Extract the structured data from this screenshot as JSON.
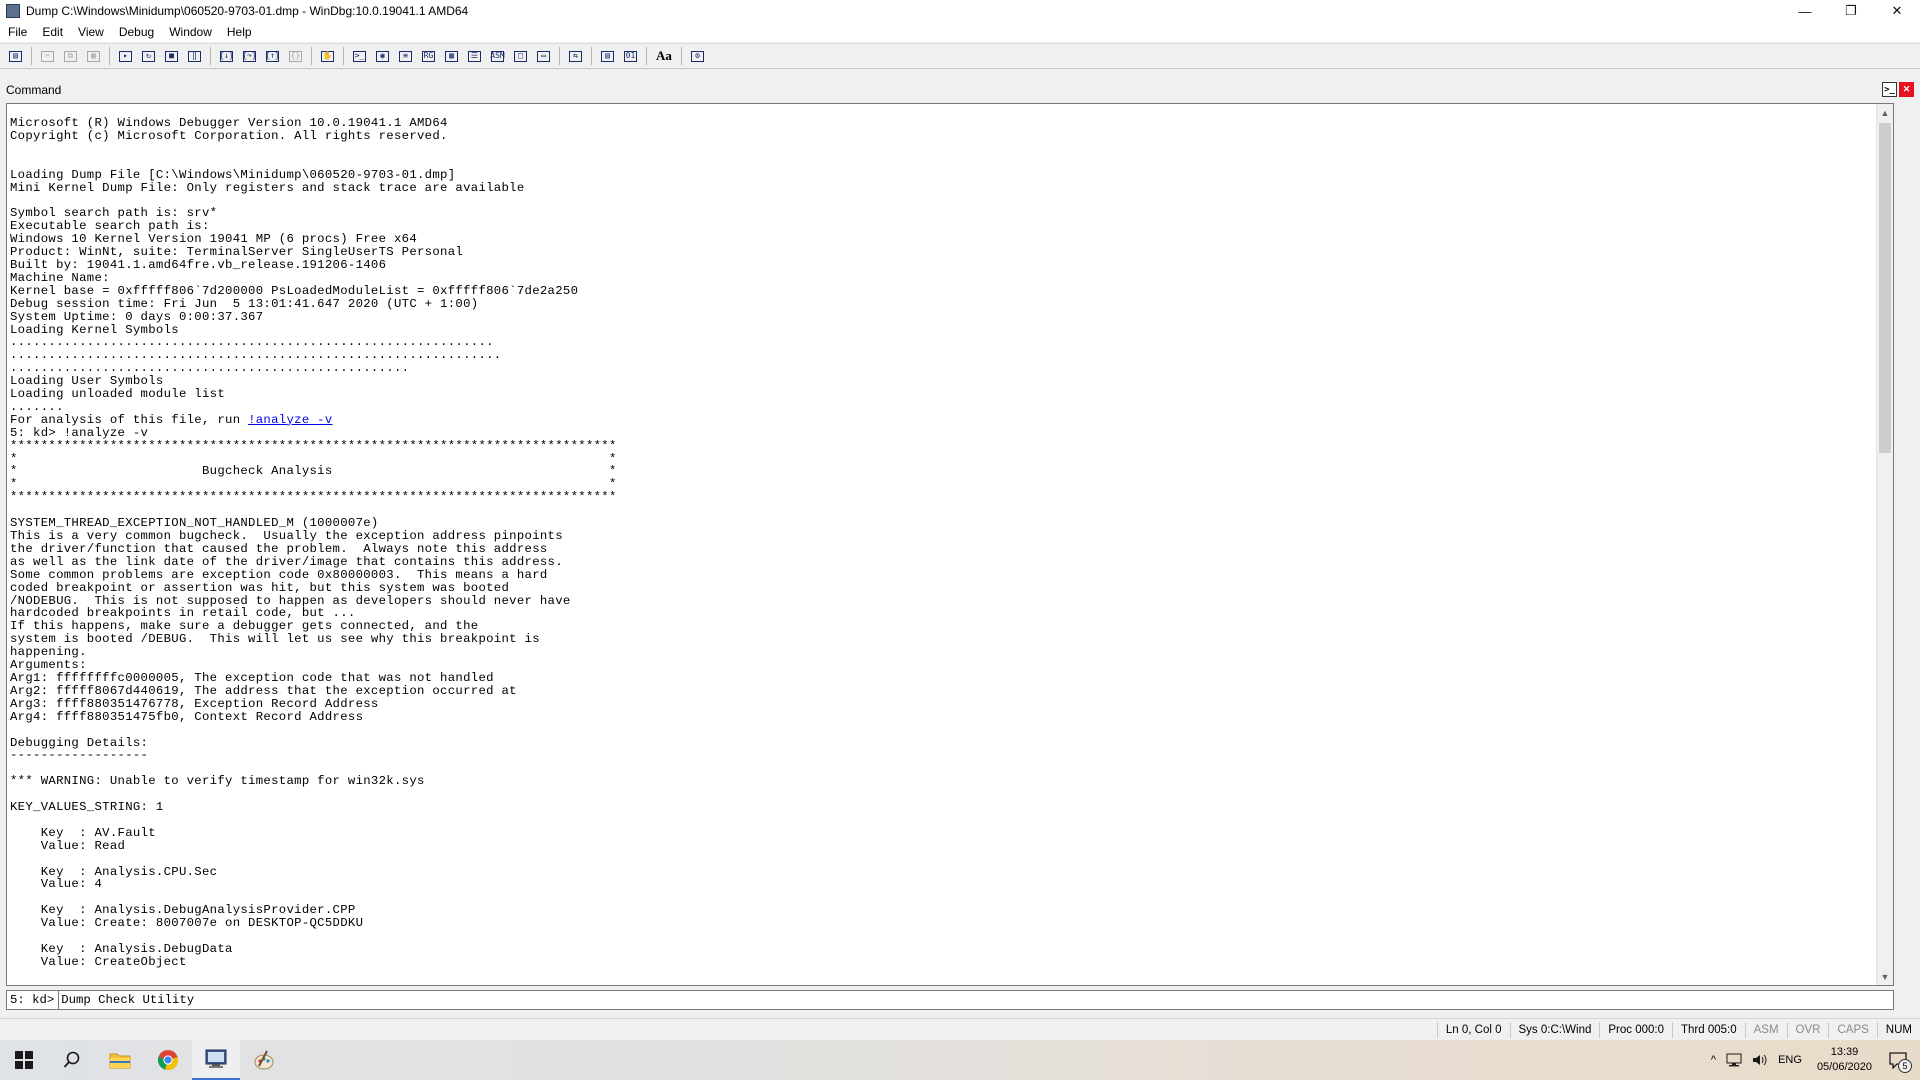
{
  "window": {
    "title": "Dump C:\\Windows\\Minidump\\060520-9703-01.dmp - WinDbg:10.0.19041.1 AMD64",
    "icon": "windbg-app-icon",
    "controls": {
      "minimize": "—",
      "restore": "❐",
      "close": "✕"
    }
  },
  "menu": [
    {
      "label": "File"
    },
    {
      "label": "Edit"
    },
    {
      "label": "View"
    },
    {
      "label": "Debug"
    },
    {
      "label": "Window"
    },
    {
      "label": "Help"
    }
  ],
  "toolbar": {
    "buttons": [
      {
        "icon": "open-folder-icon",
        "glyph": "▤",
        "enabled": true
      },
      {
        "icon": "cut-icon",
        "glyph": "✂",
        "enabled": false
      },
      {
        "icon": "copy-icon",
        "glyph": "⧉",
        "enabled": false
      },
      {
        "icon": "paste-icon",
        "glyph": "▦",
        "enabled": false
      },
      {
        "icon": "go-icon",
        "glyph": "▸",
        "enabled": true
      },
      {
        "icon": "restart-icon",
        "glyph": "↻",
        "enabled": true
      },
      {
        "icon": "stop-debugging-icon",
        "glyph": "■",
        "enabled": true
      },
      {
        "icon": "break-icon",
        "glyph": "‖",
        "enabled": true
      },
      {
        "icon": "step-into-icon",
        "glyph": "{↓}",
        "enabled": true
      },
      {
        "icon": "step-over-icon",
        "glyph": "{↷}",
        "enabled": true
      },
      {
        "icon": "step-out-icon",
        "glyph": "{↑}",
        "enabled": true
      },
      {
        "icon": "run-to-cursor-icon",
        "glyph": "{}",
        "enabled": false
      },
      {
        "icon": "insert-breakpoint-icon",
        "glyph": "✋",
        "enabled": true
      },
      {
        "icon": "command-window-icon",
        "glyph": ">_",
        "enabled": true
      },
      {
        "icon": "watch-window-icon",
        "glyph": "◉",
        "enabled": true
      },
      {
        "icon": "locals-window-icon",
        "glyph": "≡",
        "enabled": true
      },
      {
        "icon": "registers-window-icon",
        "glyph": "RG",
        "enabled": true
      },
      {
        "icon": "memory-window-icon",
        "glyph": "▦",
        "enabled": true
      },
      {
        "icon": "call-stack-window-icon",
        "glyph": "☰",
        "enabled": true
      },
      {
        "icon": "disassembly-window-icon",
        "glyph": "ASM",
        "enabled": true
      },
      {
        "icon": "scratch-pad-icon",
        "glyph": "□",
        "enabled": true
      },
      {
        "icon": "processes-threads-icon",
        "glyph": "▭",
        "enabled": true
      },
      {
        "icon": "source-mode-icon",
        "glyph": "⇆",
        "enabled": true
      },
      {
        "icon": "source-mode-on-icon",
        "glyph": "▤",
        "enabled": true
      },
      {
        "icon": "hex-mode-icon",
        "glyph": "01",
        "enabled": true
      },
      {
        "icon": "font-icon",
        "glyph": "Aa",
        "enabled": true
      },
      {
        "icon": "options-icon",
        "glyph": "⚙",
        "enabled": true
      }
    ]
  },
  "command_window": {
    "title": "Command",
    "header_icons": {
      "prompt": ">_",
      "close": "✕"
    },
    "output_before_link": "Microsoft (R) Windows Debugger Version 10.0.19041.1 AMD64\nCopyright (c) Microsoft Corporation. All rights reserved.\n\n\nLoading Dump File [C:\\Windows\\Minidump\\060520-9703-01.dmp]\nMini Kernel Dump File: Only registers and stack trace are available\n\nSymbol search path is: srv*\nExecutable search path is: \nWindows 10 Kernel Version 19041 MP (6 procs) Free x64\nProduct: WinNt, suite: TerminalServer SingleUserTS Personal\nBuilt by: 19041.1.amd64fre.vb_release.191206-1406\nMachine Name:\nKernel base = 0xfffff806`7d200000 PsLoadedModuleList = 0xfffff806`7de2a250\nDebug session time: Fri Jun  5 13:01:41.647 2020 (UTC + 1:00)\nSystem Uptime: 0 days 0:00:37.367\nLoading Kernel Symbols\n...............................................................\n................................................................\n....................................................\nLoading User Symbols\nLoading unloaded module list\n.......\nFor analysis of this file, run ",
    "analyze_link": "!analyze -v",
    "output_after_link": "\n5: kd> !analyze -v\n*******************************************************************************\n*                                                                             *\n*                        Bugcheck Analysis                                    *\n*                                                                             *\n*******************************************************************************\n\nSYSTEM_THREAD_EXCEPTION_NOT_HANDLED_M (1000007e)\nThis is a very common bugcheck.  Usually the exception address pinpoints\nthe driver/function that caused the problem.  Always note this address\nas well as the link date of the driver/image that contains this address.\nSome common problems are exception code 0x80000003.  This means a hard\ncoded breakpoint or assertion was hit, but this system was booted\n/NODEBUG.  This is not supposed to happen as developers should never have\nhardcoded breakpoints in retail code, but ...\nIf this happens, make sure a debugger gets connected, and the\nsystem is booted /DEBUG.  This will let us see why this breakpoint is\nhappening.\nArguments:\nArg1: ffffffffc0000005, The exception code that was not handled\nArg2: fffff8067d440619, The address that the exception occurred at\nArg3: ffff880351476778, Exception Record Address\nArg4: ffff880351475fb0, Context Record Address\n\nDebugging Details:\n------------------\n\n*** WARNING: Unable to verify timestamp for win32k.sys\n\nKEY_VALUES_STRING: 1\n\n    Key  : AV.Fault\n    Value: Read\n\n    Key  : Analysis.CPU.Sec\n    Value: 4\n\n    Key  : Analysis.DebugAnalysisProvider.CPP\n    Value: Create: 8007007e on DESKTOP-QC5DDKU\n\n    Key  : Analysis.DebugData\n    Value: CreateObject",
    "prompt": "5: kd>",
    "input_value": "Dump Check Utility "
  },
  "status_bar": [
    {
      "label": "Ln 0, Col 0",
      "active": true
    },
    {
      "label": "Sys 0:C:\\Wind",
      "active": true
    },
    {
      "label": "Proc 000:0",
      "active": true
    },
    {
      "label": "Thrd 005:0",
      "active": true
    },
    {
      "label": "ASM",
      "active": false
    },
    {
      "label": "OVR",
      "active": false
    },
    {
      "label": "CAPS",
      "active": false
    },
    {
      "label": "NUM",
      "active": true
    }
  ],
  "taskbar": {
    "apps": [
      {
        "icon": "windows-start-icon",
        "active": false
      },
      {
        "icon": "search-icon",
        "active": false
      },
      {
        "icon": "file-explorer-icon",
        "active": false
      },
      {
        "icon": "chrome-icon",
        "active": false
      },
      {
        "icon": "windbg-icon",
        "active": true
      },
      {
        "icon": "paint-icon",
        "active": false
      }
    ],
    "tray": {
      "chevron": "^",
      "language": "ENG",
      "time": "13:39",
      "date": "05/06/2020",
      "notification_count": "5"
    }
  },
  "colors": {
    "link": "#0000ee",
    "close_red": "#e81123",
    "taskbar_active_underline": "#3a6fd1"
  }
}
